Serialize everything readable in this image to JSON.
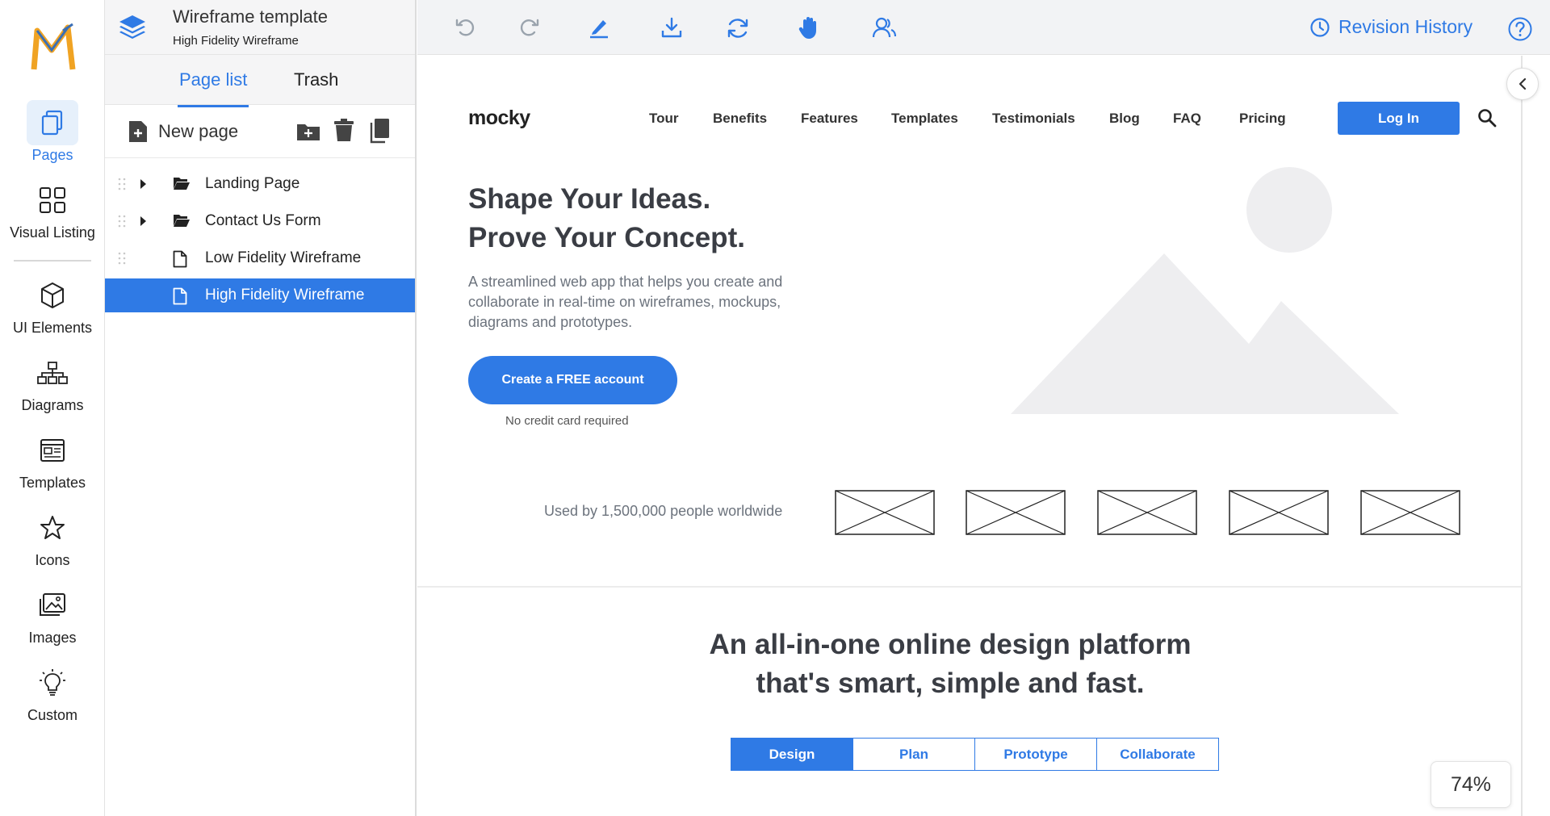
{
  "rail": {
    "items": [
      {
        "label": "Pages"
      },
      {
        "label": "Visual Listing"
      },
      {
        "label": "UI Elements"
      },
      {
        "label": "Diagrams"
      },
      {
        "label": "Templates"
      },
      {
        "label": "Icons"
      },
      {
        "label": "Images"
      },
      {
        "label": "Custom"
      }
    ]
  },
  "panel": {
    "title": "Wireframe template",
    "subtitle": "High Fidelity Wireframe",
    "tabs": [
      "Page list",
      "Trash"
    ],
    "new_page": "New page",
    "tree": [
      {
        "label": "Landing Page",
        "type": "folder"
      },
      {
        "label": "Contact Us Form",
        "type": "folder"
      },
      {
        "label": "Low Fidelity Wireframe",
        "type": "page"
      },
      {
        "label": "High Fidelity Wireframe",
        "type": "page",
        "selected": true
      }
    ]
  },
  "toolbar": {
    "revision_history": "Revision History"
  },
  "canvas": {
    "logo": "mocky",
    "nav": [
      "Tour",
      "Benefits",
      "Features",
      "Templates",
      "Testimonials",
      "Blog",
      "FAQ",
      "Pricing"
    ],
    "login": "Log In",
    "hero_title_1": "Shape Your Ideas.",
    "hero_title_2": "Prove Your Concept.",
    "hero_sub": "A streamlined web app that helps you create and collaborate in real-time on wireframes, mockups, diagrams and prototypes.",
    "cta": "Create a FREE account",
    "cta_note": "No credit card required",
    "used_by": "Used by 1,500,000 people worldwide",
    "section_title_1": "An all-in-one online design platform",
    "section_title_2": "that's smart, simple and fast.",
    "segments": [
      "Design",
      "Plan",
      "Prototype",
      "Collaborate"
    ]
  },
  "zoom": "74%",
  "colors": {
    "accent": "#2f7ae5",
    "logo_orange": "#f0a323"
  }
}
